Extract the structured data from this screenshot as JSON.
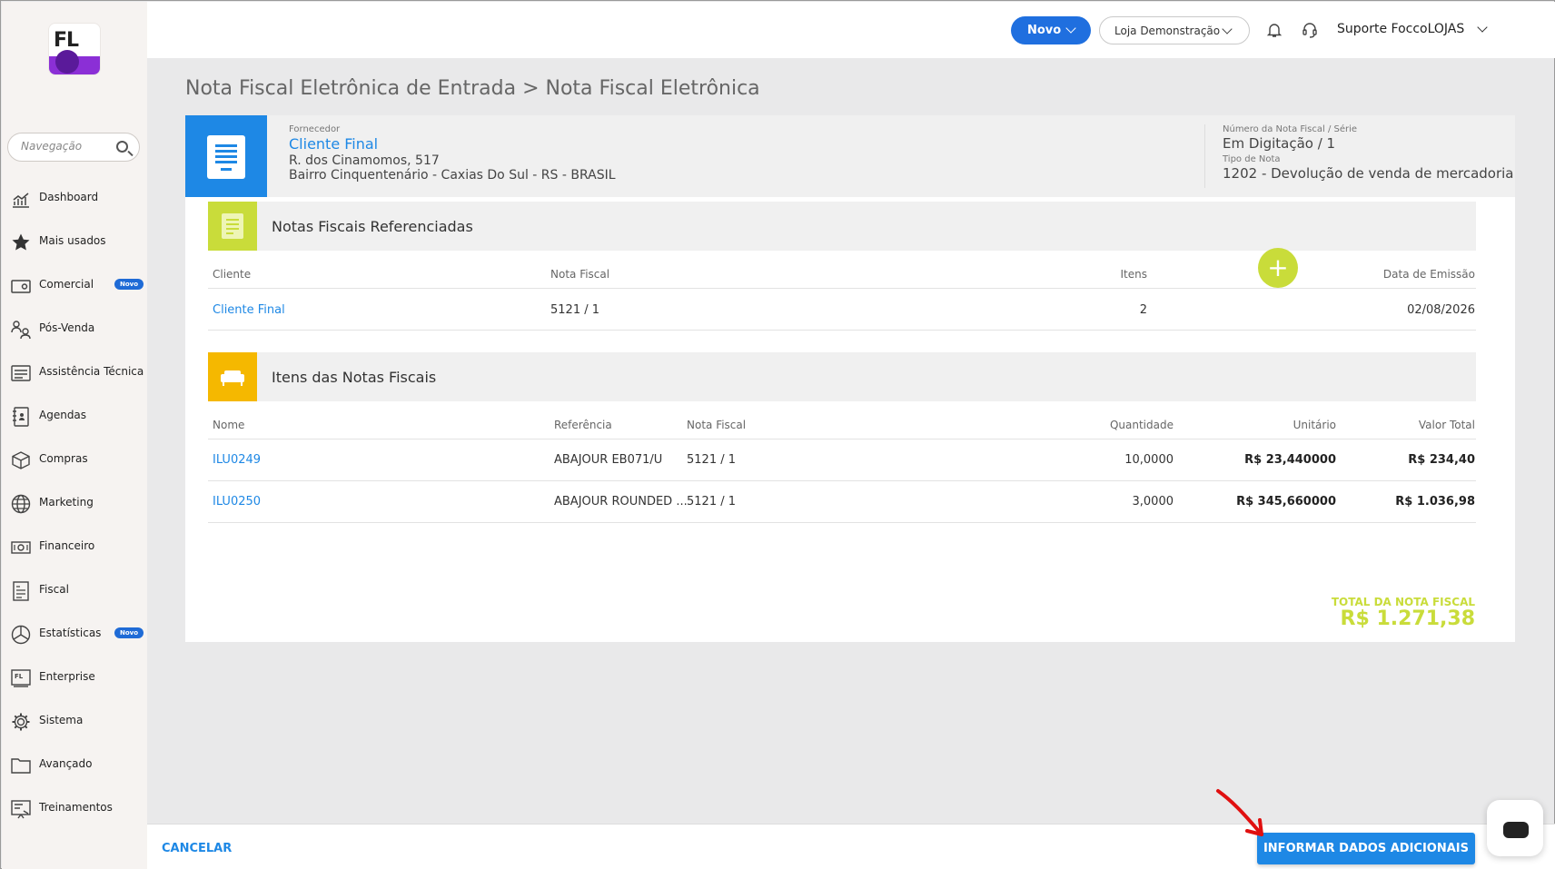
{
  "sidebar": {
    "logo_text": "FL",
    "search_placeholder": "Navegação",
    "items": [
      {
        "label": "Dashboard",
        "icon": "chart-icon"
      },
      {
        "label": "Mais usados",
        "icon": "star-icon"
      },
      {
        "label": "Comercial",
        "icon": "wallet-icon",
        "badge": "Novo"
      },
      {
        "label": "Pós-Venda",
        "icon": "people-exchange-icon"
      },
      {
        "label": "Assistência Técnica",
        "icon": "tools-icon"
      },
      {
        "label": "Agendas",
        "icon": "agenda-icon"
      },
      {
        "label": "Compras",
        "icon": "box-icon"
      },
      {
        "label": "Marketing",
        "icon": "globe-icon"
      },
      {
        "label": "Financeiro",
        "icon": "money-icon"
      },
      {
        "label": "Fiscal",
        "icon": "receipt-icon"
      },
      {
        "label": "Estatísticas",
        "icon": "pie-chart-icon",
        "badge": "Novo"
      },
      {
        "label": "Enterprise",
        "icon": "enterprise-icon"
      },
      {
        "label": "Sistema",
        "icon": "gear-icon"
      },
      {
        "label": "Avançado",
        "icon": "folder-icon"
      },
      {
        "label": "Treinamentos",
        "icon": "training-icon"
      }
    ]
  },
  "topbar": {
    "novo_label": "Novo",
    "store_label": "Loja Demonstração",
    "user_label": "Suporte FoccoLOJAS"
  },
  "page": {
    "title": "Nota Fiscal Eletrônica de Entrada > Nota Fiscal Eletrônica"
  },
  "header": {
    "supplier_label": "Fornecedor",
    "supplier_name": "Cliente Final",
    "address_line1": "R. dos Cinamomos, 517",
    "address_line2": "Bairro Cinquentenário - Caxias Do Sul - RS - BRASIL",
    "number_label": "Número da Nota Fiscal / Série",
    "number_value": "Em Digitação / 1",
    "type_label": "Tipo de Nota",
    "type_value": "1202 - Devolução de venda de mercadoria"
  },
  "referenced": {
    "title": "Notas Fiscais Referenciadas",
    "columns": {
      "cliente": "Cliente",
      "nota": "Nota Fiscal",
      "itens": "Itens",
      "data": "Data de Emissão"
    },
    "rows": [
      {
        "cliente": "Cliente Final",
        "nota": "5121 / 1",
        "itens": "2",
        "data": "02/08/2026"
      }
    ]
  },
  "items": {
    "title": "Itens das Notas Fiscais",
    "columns": {
      "nome": "Nome",
      "referencia": "Referência",
      "nota": "Nota Fiscal",
      "quantidade": "Quantidade",
      "unitario": "Unitário",
      "total": "Valor Total"
    },
    "rows": [
      {
        "nome": "ILU0249",
        "referencia": "ABAJOUR EB071/U",
        "nota": "5121 / 1",
        "quantidade": "10,0000",
        "unitario": "R$ 23,440000",
        "total": "R$ 234,40"
      },
      {
        "nome": "ILU0250",
        "referencia": "ABAJOUR ROUNDED ...",
        "nota": "5121 / 1",
        "quantidade": "3,0000",
        "unitario": "R$ 345,660000",
        "total": "R$ 1.036,98"
      }
    ],
    "total_label": "TOTAL DA NOTA FISCAL",
    "total_value": "R$ 1.271,38"
  },
  "footer": {
    "cancel_label": "CANCELAR",
    "primary_label": "INFORMAR DADOS ADICIONAIS"
  },
  "colors": {
    "accent_blue": "#1e88e5",
    "accent_lime": "#c9dc3a",
    "accent_yellow": "#f5b800",
    "brand_purple": "#8b2fd6"
  }
}
